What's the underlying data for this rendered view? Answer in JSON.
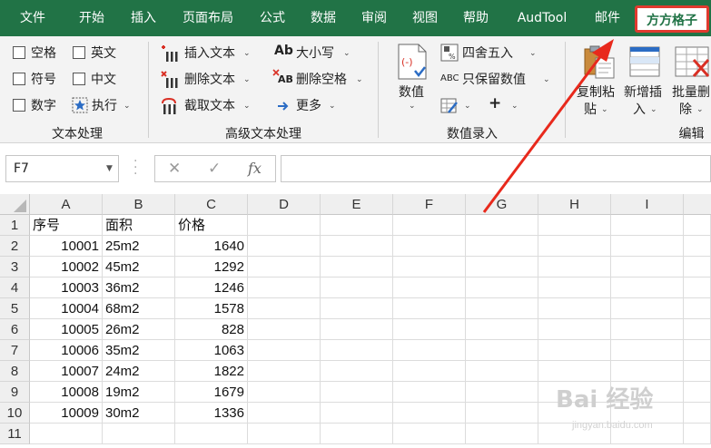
{
  "tabs": [
    "文件",
    "开始",
    "插入",
    "页面布局",
    "公式",
    "数据",
    "审阅",
    "视图",
    "帮助",
    "AudTool",
    "邮件",
    "方方格子"
  ],
  "active_tab_index": 11,
  "ribbon": {
    "text_group": {
      "label": "文本处理",
      "checkboxes": [
        "空格",
        "英文",
        "符号",
        "中文",
        "数字"
      ],
      "execute_label": "执行"
    },
    "advanced_text_group": {
      "label": "高级文本处理",
      "insert_text": "插入文本",
      "delete_text": "删除文本",
      "cut_text": "截取文本",
      "case": "大小写",
      "delete_spaces": "删除空格",
      "more": "更多"
    },
    "number_group": {
      "label": "数值录入",
      "value_button": "数值",
      "round": "四舍五入",
      "keep_numbers": "只保留数值",
      "plus": "+"
    },
    "edit_group": {
      "label": "编辑",
      "copy_paste_l1": "复制粘",
      "copy_paste_l2": "贴",
      "new_insert_l1": "新增插",
      "new_insert_l2": "入",
      "batch_delete_l1": "批量删",
      "batch_delete_l2": "除"
    },
    "icon_text": {
      "case_ab": "Ab",
      "delete_spaces_ab": "AB",
      "keep_abc": "ABC",
      "fx": "fx"
    }
  },
  "formula_bar": {
    "name_box": "F7",
    "formula": ""
  },
  "columns": [
    "A",
    "B",
    "C",
    "D",
    "E",
    "F",
    "G",
    "H",
    "I"
  ],
  "rows": [
    {
      "num": "1",
      "a": "序号",
      "b": "面积",
      "c": "价格"
    },
    {
      "num": "2",
      "a": "10001",
      "b": "25m2",
      "c": "1640"
    },
    {
      "num": "3",
      "a": "10002",
      "b": "45m2",
      "c": "1292"
    },
    {
      "num": "4",
      "a": "10003",
      "b": "36m2",
      "c": "1246"
    },
    {
      "num": "5",
      "a": "10004",
      "b": "68m2",
      "c": "1578"
    },
    {
      "num": "6",
      "a": "10005",
      "b": "26m2",
      "c": "828"
    },
    {
      "num": "7",
      "a": "10006",
      "b": "35m2",
      "c": "1063"
    },
    {
      "num": "8",
      "a": "10007",
      "b": "24m2",
      "c": "1822"
    },
    {
      "num": "9",
      "a": "10008",
      "b": "19m2",
      "c": "1679"
    },
    {
      "num": "10",
      "a": "10009",
      "b": "30m2",
      "c": "1336"
    },
    {
      "num": "11",
      "a": "",
      "b": "",
      "c": ""
    }
  ],
  "watermark": {
    "main": "Bai 经验",
    "sub": "jingyan.baidu.com"
  },
  "colors": {
    "excel_green": "#217346",
    "highlight_red": "#e03a2f",
    "arrow_red": "#e8291c"
  }
}
